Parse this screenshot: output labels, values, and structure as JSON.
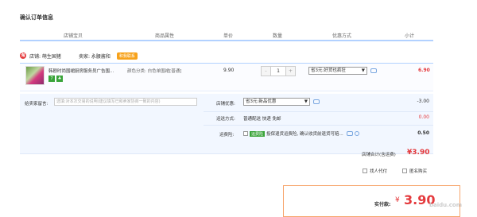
{
  "section_title": "确认订单信息",
  "columns": {
    "shop_item": "店铺宝贝",
    "attributes": "商品属性",
    "unit_price": "单价",
    "quantity": "数量",
    "discount": "优惠方式",
    "subtotal": "小计"
  },
  "shop": {
    "label": "店铺: 萌生国猪",
    "seller": "卖家: 永腰酱和",
    "contact": "和我联系"
  },
  "item": {
    "title": "韩剧时尚围裙厨房服务员广告围...",
    "attr": "颜色分类: 白色单围裙[普通]",
    "price": "9.90",
    "quantity": "1",
    "minus": "-",
    "plus": "+",
    "discount_select": "省3元:好货也疯狂",
    "total": "6.90",
    "tag7": "7",
    "tag_leaf": "♣"
  },
  "message": {
    "label": "给卖家留言:",
    "placeholder": "选填:对本次交易的说明(建议填写已和卖家协商一致的内容)"
  },
  "shop_discount": {
    "label": "店铺优惠:",
    "select": "省3元:新品优惠",
    "value": "-3.00"
  },
  "shipping": {
    "label": "运送方式:",
    "text": "普通配送 快递 免邮",
    "value": "0.00"
  },
  "insurance": {
    "label": "运费险:",
    "badge": "运费险",
    "text": "投保退货运费险, 确认收货前退货可赔...",
    "value": "0.50"
  },
  "shop_total": {
    "label": "店铺合计(含运费)",
    "value": "¥3.90"
  },
  "options": {
    "proxy_pay": "找人代付",
    "anonymous": "匿名购买"
  },
  "payment": {
    "label": "实付款:",
    "yen": "¥",
    "value": "3.90"
  },
  "watermark": "baidu.com"
}
